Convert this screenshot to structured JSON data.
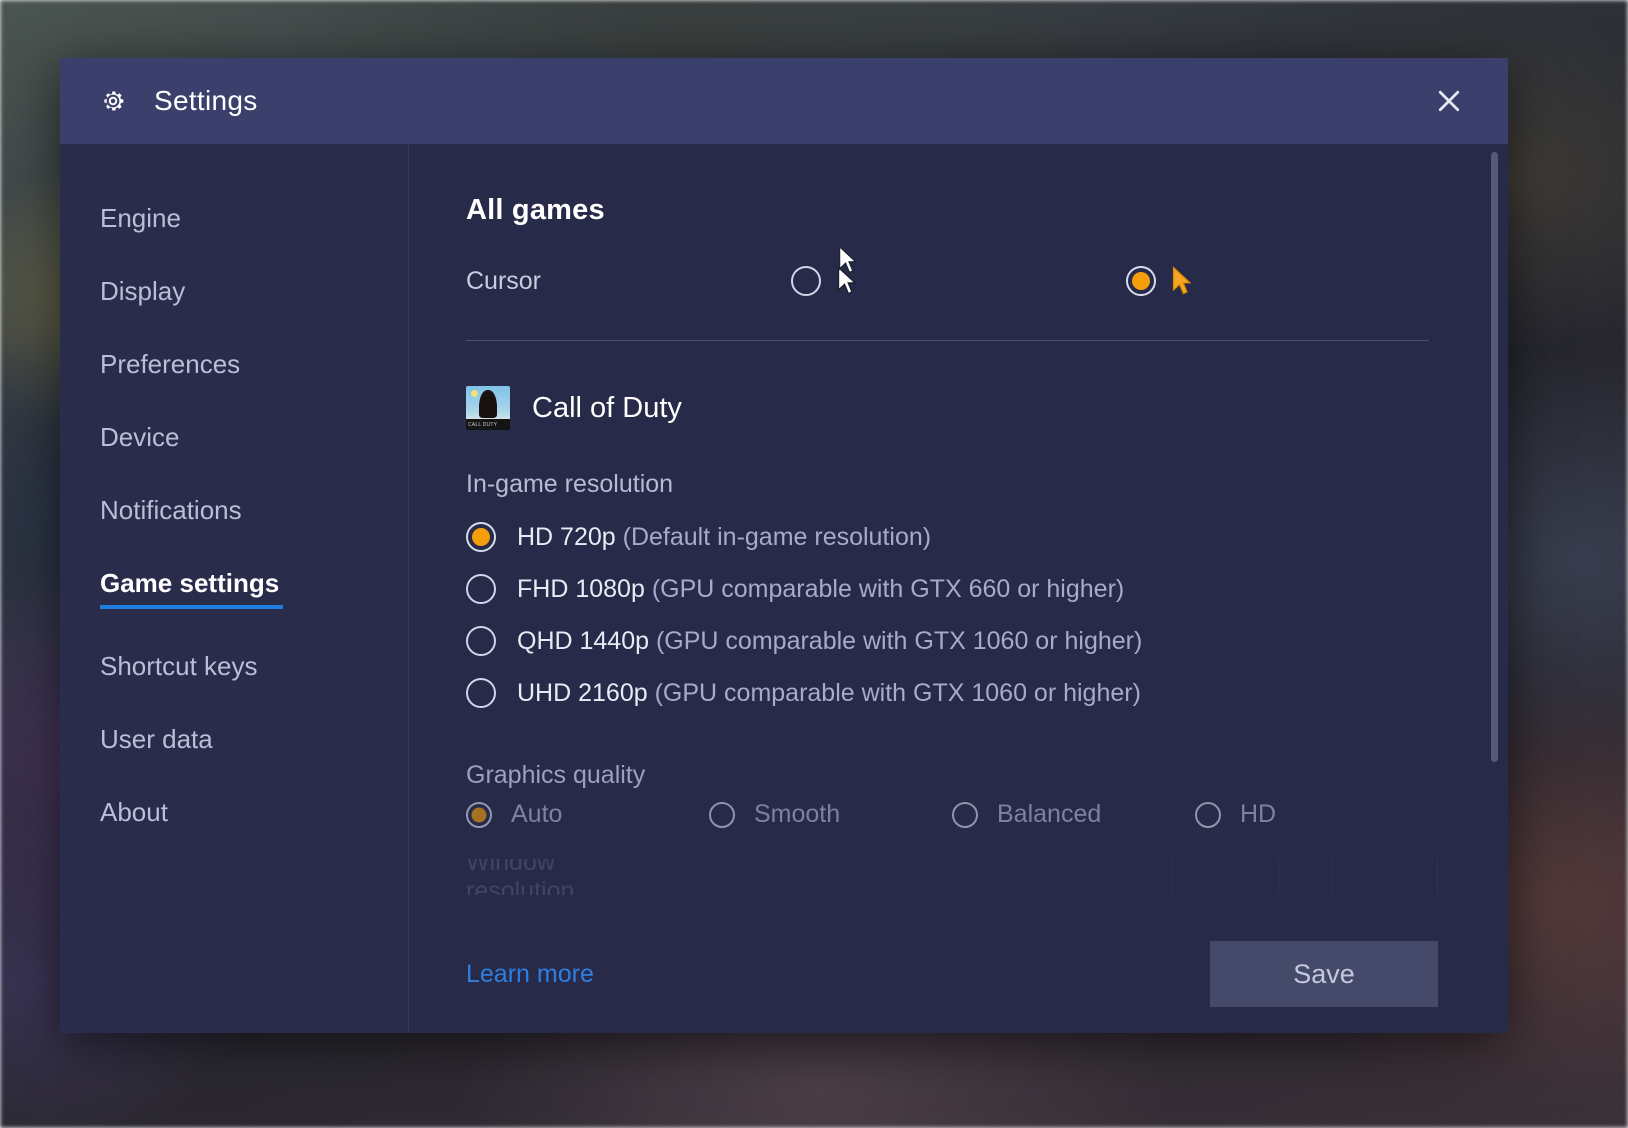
{
  "window": {
    "title": "Settings",
    "gear_icon": "gear-icon",
    "close_icon": "close-icon"
  },
  "sidebar": {
    "items": [
      {
        "label": "Engine",
        "active": false
      },
      {
        "label": "Display",
        "active": false
      },
      {
        "label": "Preferences",
        "active": false
      },
      {
        "label": "Device",
        "active": false
      },
      {
        "label": "Notifications",
        "active": false
      },
      {
        "label": "Game settings",
        "active": true
      },
      {
        "label": "Shortcut keys",
        "active": false
      },
      {
        "label": "User data",
        "active": false
      },
      {
        "label": "About",
        "active": false
      }
    ],
    "active_underline_color": "#1d7fe0"
  },
  "main": {
    "all_games": {
      "title": "All games",
      "cursor_label": "Cursor",
      "cursor_options": [
        {
          "icon": "cursor-arrow-white-icon",
          "selected": false
        },
        {
          "icon": "cursor-arrow-yellow-icon",
          "selected": true
        }
      ]
    },
    "game": {
      "name": "Call of Duty",
      "icon": "call-of-duty-thumbnail-icon",
      "icon_caption": "CALL DUTY",
      "resolution": {
        "label": "In-game resolution",
        "options": [
          {
            "name": "HD 720p",
            "note": "(Default in-game resolution)",
            "selected": true
          },
          {
            "name": "FHD 1080p",
            "note": "(GPU comparable with GTX 660 or higher)",
            "selected": false
          },
          {
            "name": "QHD 1440p",
            "note": "(GPU comparable with GTX 1060 or higher)",
            "selected": false
          },
          {
            "name": "UHD 2160p",
            "note": "(GPU comparable with GTX 1060 or higher)",
            "selected": false
          }
        ]
      },
      "graphics_quality": {
        "label": "Graphics quality",
        "options": [
          {
            "label": "Auto",
            "selected": true
          },
          {
            "label": "Smooth",
            "selected": false
          },
          {
            "label": "Balanced",
            "selected": false
          },
          {
            "label": "HD",
            "selected": false
          }
        ]
      },
      "clipped_below": {
        "label": "Window resolution"
      }
    }
  },
  "footer": {
    "learn_more": "Learn more",
    "save": "Save"
  },
  "colors": {
    "accent_orange": "#f59e0b",
    "link_blue": "#2f7fe0",
    "active_underline": "#1d7fe0",
    "dialog_bg": "#272a48",
    "titlebar_bg": "#3b3f6b",
    "sidebar_bg": "#2a2c4c"
  }
}
